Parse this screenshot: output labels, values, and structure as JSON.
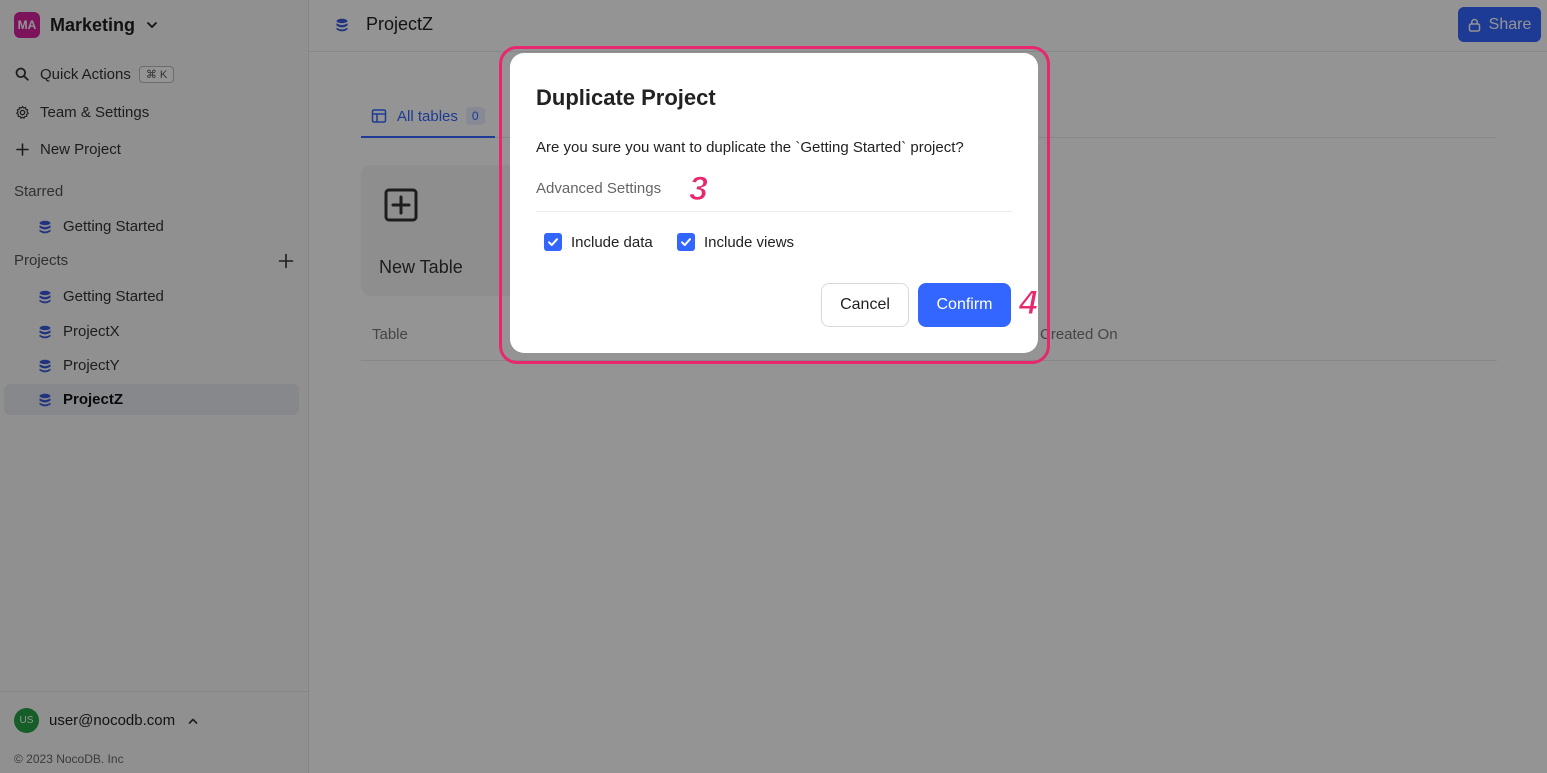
{
  "workspace": {
    "initials": "MA",
    "name": "Marketing"
  },
  "nav": {
    "quick_actions": "Quick Actions",
    "quick_actions_shortcut": "⌘ K",
    "team_settings": "Team & Settings",
    "new_project": "New Project"
  },
  "starred": {
    "label": "Starred",
    "items": [
      {
        "label": "Getting Started"
      }
    ]
  },
  "projects": {
    "label": "Projects",
    "items": [
      {
        "label": "Getting Started"
      },
      {
        "label": "ProjectX"
      },
      {
        "label": "ProjectY"
      },
      {
        "label": "ProjectZ",
        "active": true
      }
    ]
  },
  "footer": {
    "user_initials": "US",
    "user_email": "user@nocodb.com",
    "copyright": "© 2023 NocoDB. Inc"
  },
  "main": {
    "title": "ProjectZ",
    "share_label": "Share",
    "tab_label": "All tables",
    "tab_count": "0",
    "new_table_label": "New Table",
    "columns": {
      "table": "Table",
      "created_on": "Created On"
    }
  },
  "dialog": {
    "title": "Duplicate Project",
    "message": "Are you sure you want to duplicate the `Getting Started` project?",
    "advanced_settings": "Advanced Settings",
    "include_data": "Include data",
    "include_views": "Include views",
    "include_data_checked": true,
    "include_views_checked": true,
    "cancel": "Cancel",
    "confirm": "Confirm"
  },
  "annotations": {
    "step_a": "3",
    "step_b": "4"
  },
  "colors": {
    "accent": "#3366ff",
    "annotation": "#e8276e",
    "workspace_avatar": "#d6249f",
    "user_avatar": "#25a244"
  },
  "icons": {
    "search": "search-icon",
    "settings": "gear-icon",
    "plus": "plus-icon",
    "database": "database-icon",
    "lock": "lock-icon",
    "table": "table-icon",
    "chevron_down": "chevron-down-icon",
    "chevron_up": "chevron-up-icon",
    "check": "check-icon"
  }
}
